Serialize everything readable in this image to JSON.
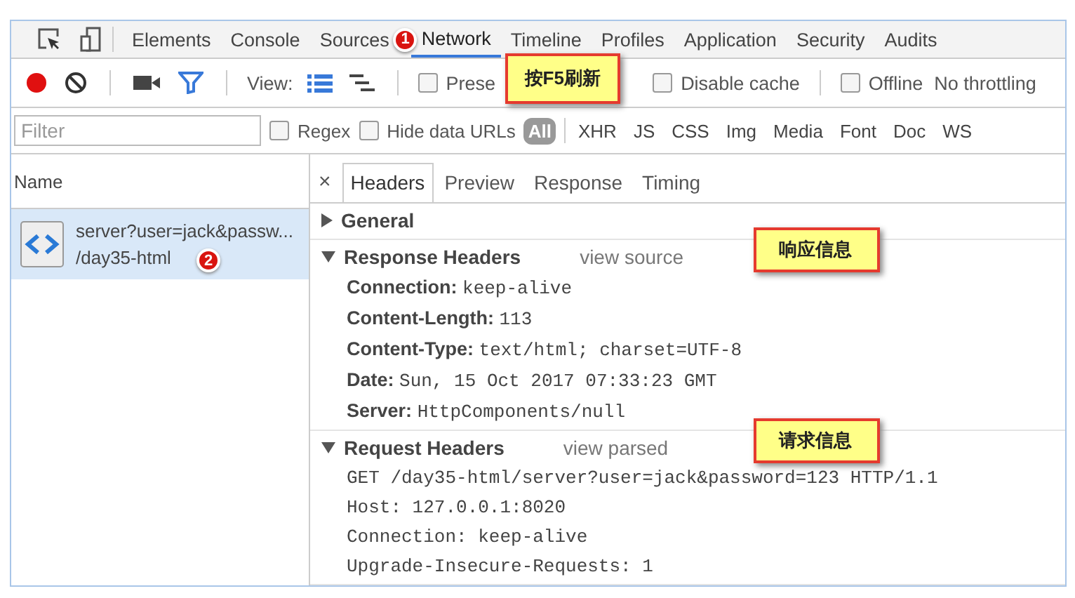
{
  "main_tabs": [
    {
      "label": "Elements",
      "selected": false
    },
    {
      "label": "Console",
      "selected": false
    },
    {
      "label": "Sources",
      "selected": false
    },
    {
      "label": "Network",
      "selected": true,
      "badge": "1"
    },
    {
      "label": "Timeline",
      "selected": false
    },
    {
      "label": "Profiles",
      "selected": false
    },
    {
      "label": "Application",
      "selected": false
    },
    {
      "label": "Security",
      "selected": false
    },
    {
      "label": "Audits",
      "selected": false
    }
  ],
  "toolbar": {
    "recording": true,
    "filter_active": true,
    "view_label": "View:",
    "view_buttons": [
      {
        "kind": "list",
        "selected": true
      },
      {
        "kind": "waterfall",
        "selected": false
      }
    ],
    "checkboxes": [
      {
        "label": "Prese",
        "checked": false,
        "note": "按F5刷新"
      },
      {
        "label": "Disable cache",
        "checked": false
      },
      {
        "label": "Offline",
        "checked": false
      }
    ],
    "throttling": "No throttling"
  },
  "filter_bar": {
    "placeholder": "Filter",
    "checkboxes": [
      {
        "label": "Regex",
        "checked": false
      },
      {
        "label": "Hide data URLs",
        "checked": false
      }
    ],
    "types": [
      {
        "label": "All",
        "selected": true
      },
      {
        "label": "XHR",
        "selected": false
      },
      {
        "label": "JS",
        "selected": false
      },
      {
        "label": "CSS",
        "selected": false
      },
      {
        "label": "Img",
        "selected": false
      },
      {
        "label": "Media",
        "selected": false
      },
      {
        "label": "Font",
        "selected": false
      },
      {
        "label": "Doc",
        "selected": false
      },
      {
        "label": "WS",
        "selected": false
      }
    ]
  },
  "requests": {
    "column": "Name",
    "rows": [
      {
        "name": "server?user=jack&passw...",
        "path": "/day35-html",
        "selected": true,
        "badge": "2"
      }
    ]
  },
  "detail": {
    "close": "×",
    "tabs": [
      {
        "label": "Headers",
        "selected": true
      },
      {
        "label": "Preview",
        "selected": false
      },
      {
        "label": "Response",
        "selected": false
      },
      {
        "label": "Timing",
        "selected": false
      }
    ],
    "sections": [
      {
        "title": "General",
        "expanded": false
      },
      {
        "title": "Response Headers",
        "expanded": true,
        "kind": "parsed",
        "link": "view source",
        "note": "响应信息",
        "rows": [
          {
            "key": "Connection:",
            "value": "keep-alive"
          },
          {
            "key": "Content-Length:",
            "value": "113"
          },
          {
            "key": "Content-Type:",
            "value": "text/html; charset=UTF-8"
          },
          {
            "key": "Date:",
            "value": "Sun, 15 Oct 2017 07:33:23 GMT"
          },
          {
            "key": "Server:",
            "value": "HttpComponents/null"
          }
        ]
      },
      {
        "title": "Request Headers",
        "expanded": true,
        "kind": "raw",
        "link": "view parsed",
        "note": "请求信息",
        "lines": [
          "GET /day35-html/server?user=jack&password=123 HTTP/1.1",
          "Host: 127.0.0.1:8020",
          "Connection: keep-alive",
          "Upgrade-Insecure-Requests: 1"
        ]
      }
    ]
  }
}
